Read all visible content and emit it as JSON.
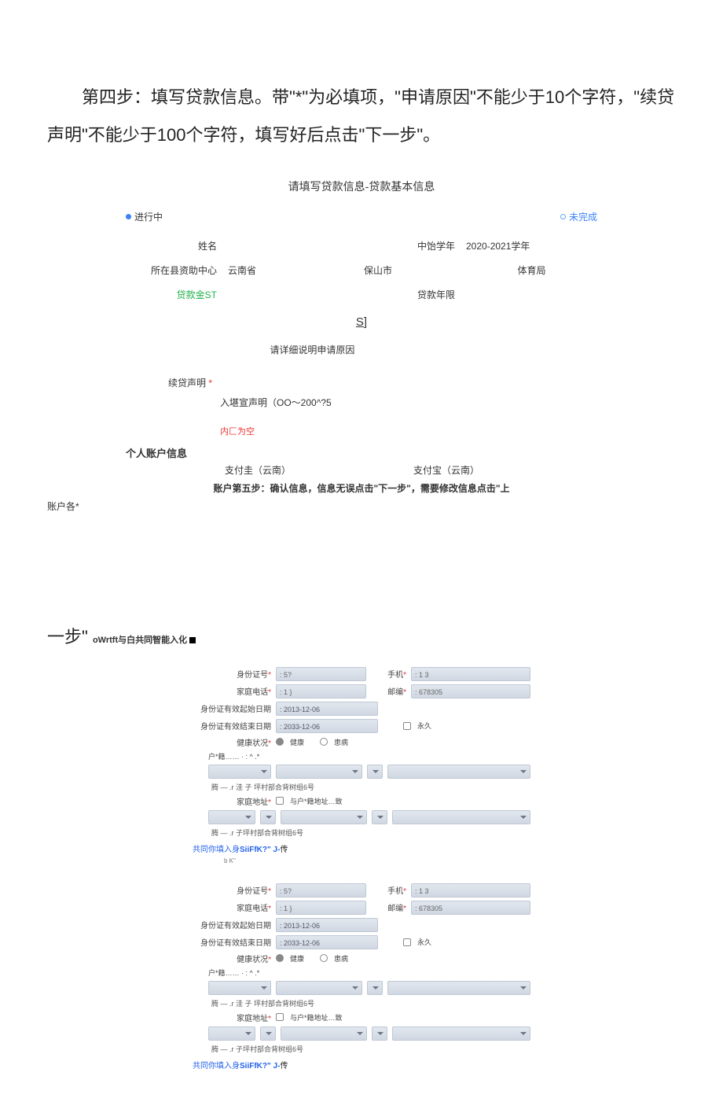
{
  "intro": "第四步：填写贷款信息。带\"*\"为必填项，\"申请原因\"不能少于10个字符，\"续贷声明\"不能少于100个字符，填写好后点击\"下一步\"。",
  "form_title": "请填写贷款信息-贷款基本信息",
  "step_in_progress": "进行中",
  "step_pending": "未完成",
  "labels": {
    "name": "姓名",
    "year": "中饴学年",
    "year_val": "2020-2021学年",
    "center": "所在县资助中心",
    "prov": "云南省",
    "city": "保山市",
    "bureau": "体育局",
    "loan_amt": "贷款金ST",
    "loan_term": "贷款年限"
  },
  "sj": "S]",
  "reason_ph": "请详细说明申请原因",
  "renew_label": "续贷声明",
  "renew_sub": "入堪宣声明（OO～200^?5",
  "err": "内匚为空",
  "acct_head": "个人账户信息",
  "acct": {
    "absent": "支付圭（云南）",
    "alipay": "支付宝（云南）"
  },
  "acct_name_lbl": "账户各*",
  "footer_note": "账户第五步：确认信息，信息无误点击\"下一步\"，需要修改信息点击\"上",
  "step5_tail": "一步\"",
  "wrtft_line": "oWrtft与白共同智能入化",
  "f": {
    "idnum": "身份证号",
    "idnum_v": ": 5?",
    "phone": "手机",
    "phone_v": ": 1                    3",
    "homephone": "家庭电话",
    "homephone_v": ": 1              }",
    "post": "邮编",
    "post_v": ": 678305",
    "startdate": "身份证有效起始日期",
    "startdate_v": ": 2013-12-06",
    "enddate": "身份证有效结束日期",
    "enddate_v": ": 2033-12-06",
    "perm": "  永久",
    "health": "健康状况",
    "healthy": "健康",
    "sick": "患病",
    "hk": "户*籍…… · : ^ .*",
    "addr1": "腾 — .r 洼 子 坪村部合背树组6号",
    "homeaddr": "家庭地址",
    "sameaddr": "与户*籍地址…致",
    "addr2": "腾 —   .r 子坪村部合背树组6号",
    "bx": "b K''"
  },
  "blue_link_a": "共同你填入身",
  "blue_link_b": "SiiFfK?\" J-",
  "blue_link_c": "传"
}
